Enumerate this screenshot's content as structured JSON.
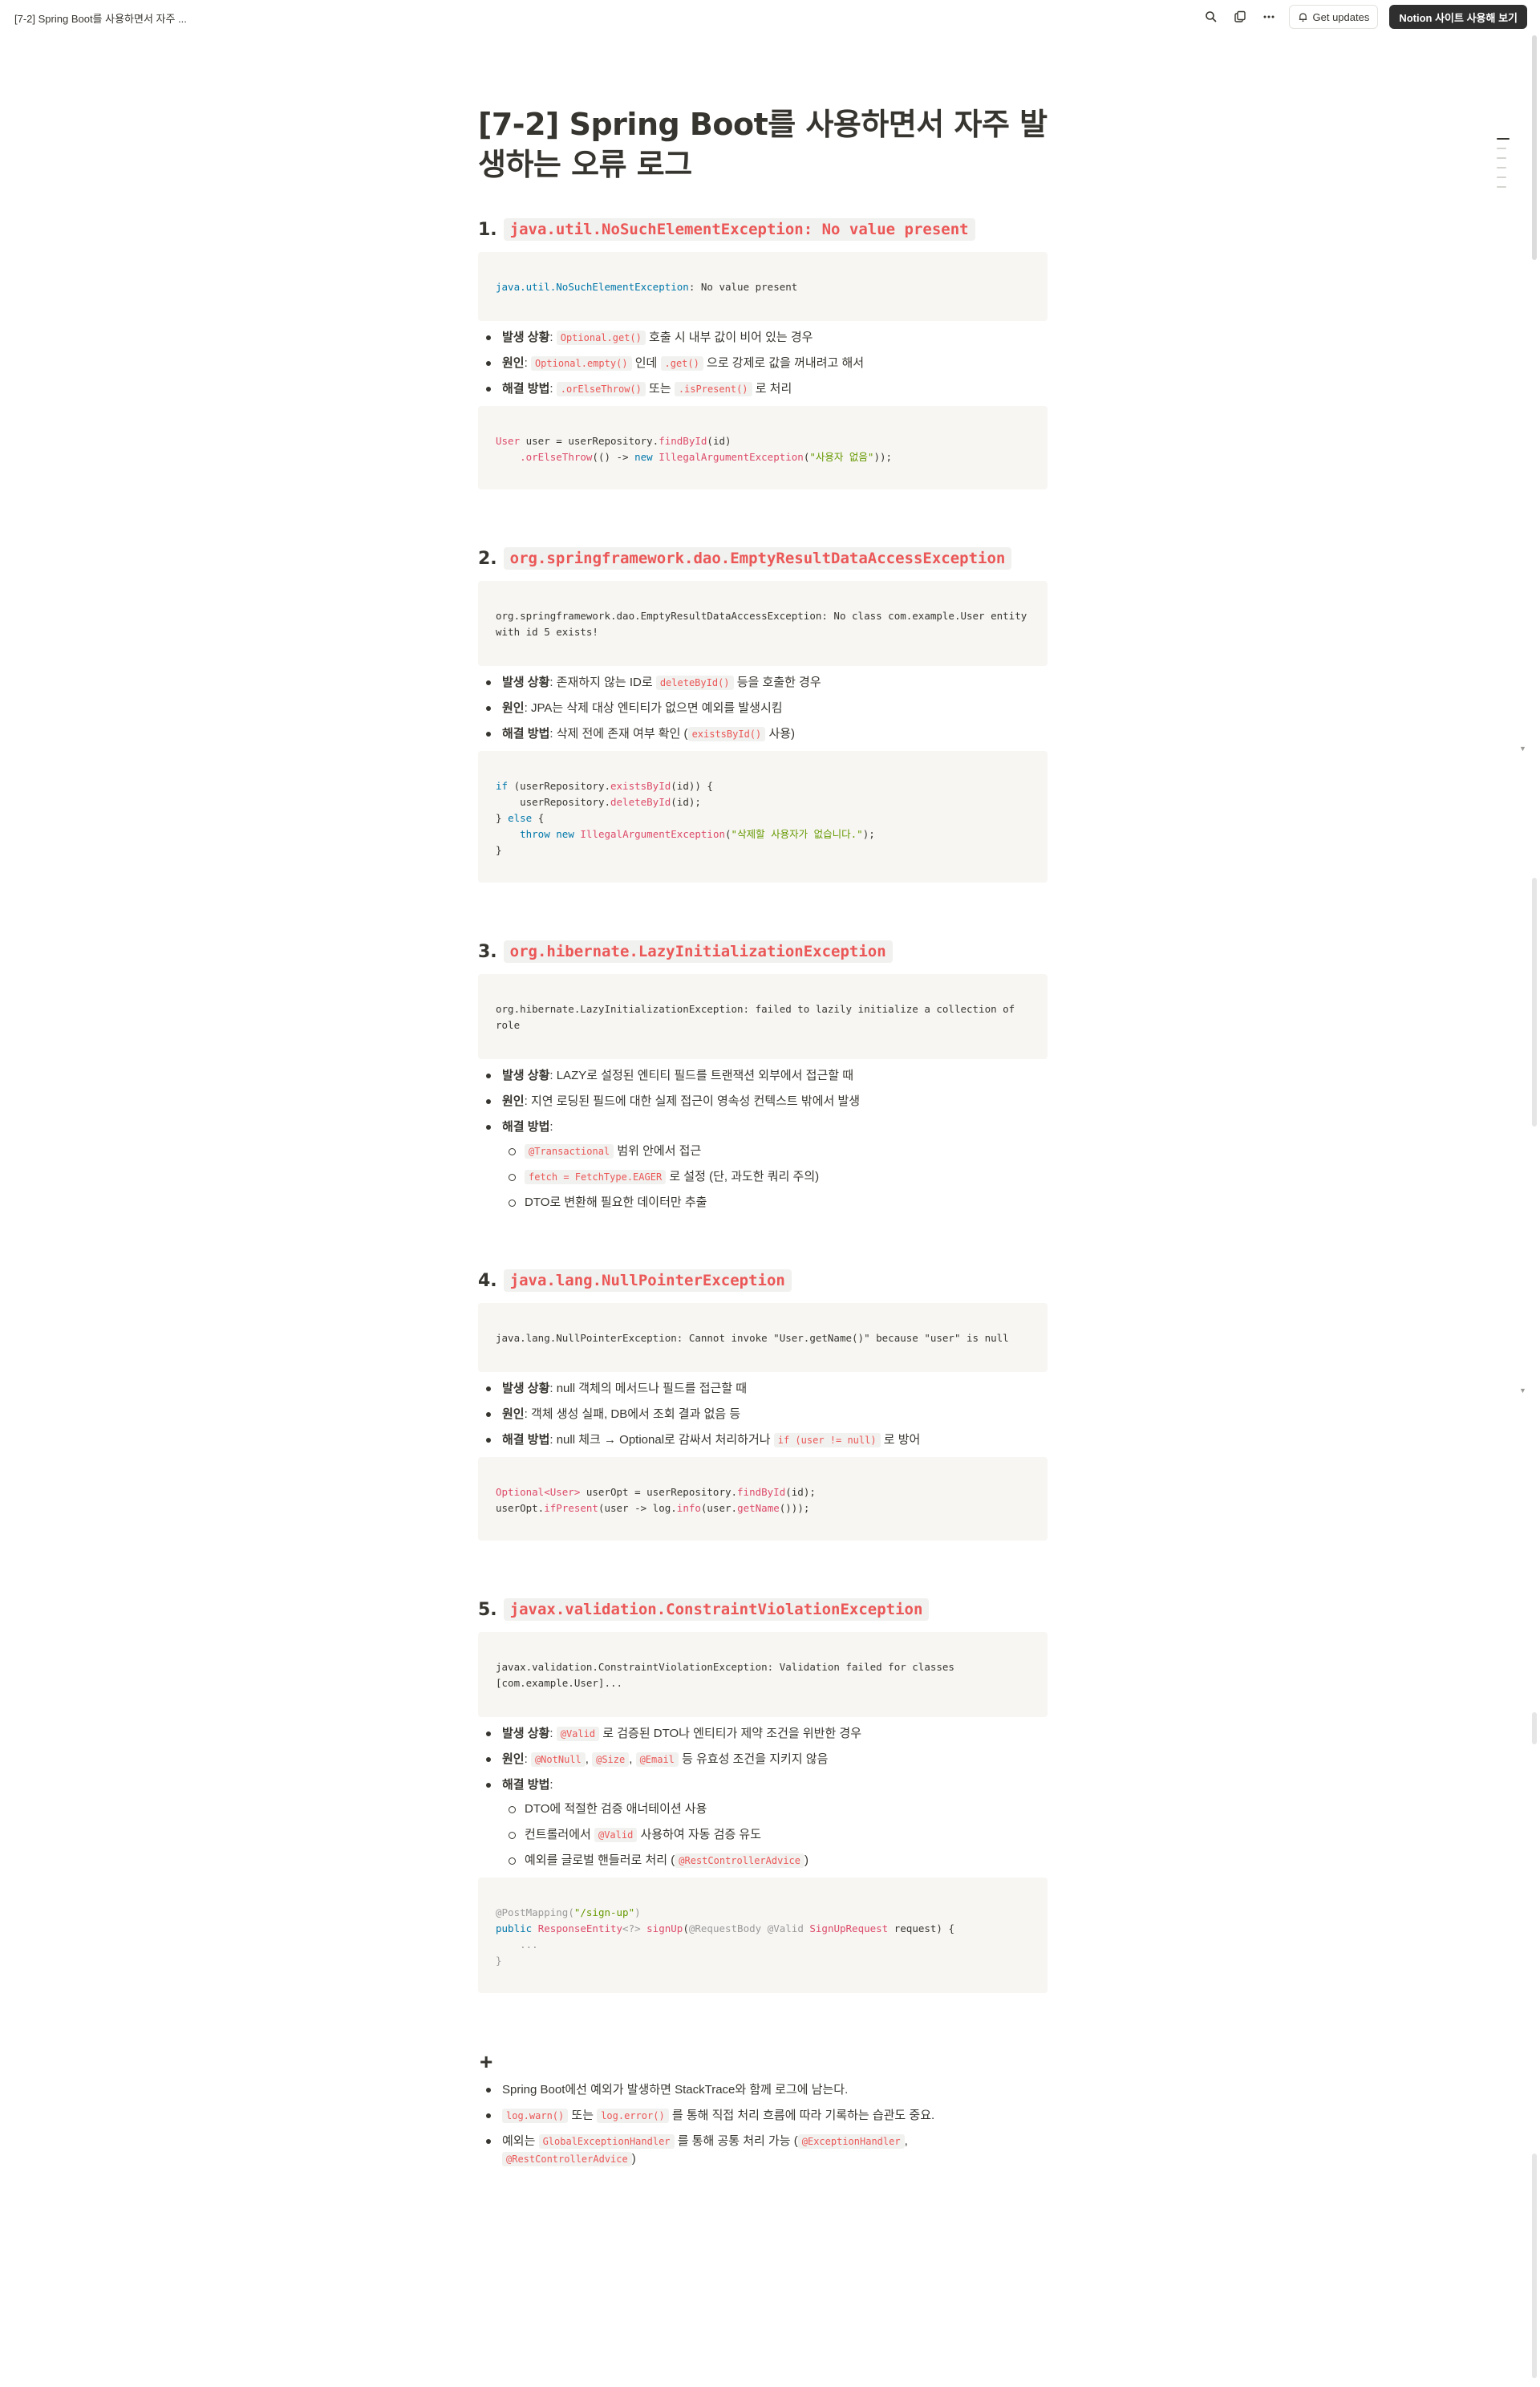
{
  "topbar": {
    "breadcrumb": "[7-2] Spring Boot를 사용하면서 자주 ...",
    "search_icon": "search-icon",
    "duplicate_icon": "duplicate-icon",
    "more_icon": "more-icon",
    "get_updates_label": "Get updates",
    "notion_button_label": "Notion 사이트 사용해 보기"
  },
  "page": {
    "title": "[7-2] Spring Boot를 사용하면서 자주 발생하는 오류 로그"
  },
  "sections": [
    {
      "num": "1.",
      "heading": "java.util.NoSuchElementException: No value present",
      "labels": {
        "situation": "발생 상황",
        "cause": "원인",
        "fix": "해결 방법"
      },
      "situation": {
        "code": "Optional.get()",
        "text": "호출 시 내부 값이 비어 있는 경우"
      },
      "cause": {
        "code1": "Optional.empty()",
        "mid": "인데",
        "code2": ".get()",
        "text": "으로 강제로 값을 꺼내려고 해서"
      },
      "fix": {
        "code1": ".orElseThrow()",
        "mid": "또는",
        "code2": ".isPresent()",
        "text": "로 처리"
      },
      "error_pkg": "java.util.",
      "error_cls": "NoSuchElementException",
      "error_rest": ": No value present",
      "code": {
        "l1_type": "User",
        "l1_var": " user = userRepository.",
        "l1_fn": "findById",
        "l1_end": "(id)",
        "l2_indent": "    ",
        "l2_fn": ".orElseThrow",
        "l2_mid": "(() -> ",
        "l2_kw": "new",
        "l2_cls": "IllegalArgumentException",
        "l2_str": "\"사용자 없음\"",
        "l2_end": "));"
      }
    },
    {
      "num": "2.",
      "heading": "org.springframework.dao.EmptyResultDataAccessException",
      "labels": {
        "situation": "발생 상황",
        "cause": "원인",
        "fix": "해결 방법"
      },
      "error": "org.springframework.dao.EmptyResultDataAccessException: No class com.example.User entity with id 5 exists!",
      "situation": {
        "pre": "존재하지 않는 ID로",
        "code": "deleteById()",
        "text": "등을 호출한 경우"
      },
      "cause": {
        "text": "JPA는 삭제 대상 엔티티가 없으면 예외를 발생시킴"
      },
      "fix": {
        "pre": "삭제 전에 존재 여부 확인 (",
        "code": "existsById()",
        "text": "사용)"
      },
      "code": {
        "l1_kw": "if",
        "l1_a": " (userRepository.",
        "l1_fn": "existsById",
        "l1_b": "(id)) {",
        "l2_a": "    userRepository.",
        "l2_fn": "deleteById",
        "l2_b": "(id);",
        "l3": "} ",
        "l3_kw": "else",
        "l3_b": " {",
        "l4_kw1": "throw",
        "l4_kw2": "new",
        "l4_cls": "IllegalArgumentException",
        "l4_str": "\"삭제할 사용자가 없습니다.\"",
        "l4_end": ");",
        "l5": "}"
      }
    },
    {
      "num": "3.",
      "heading": "org.hibernate.LazyInitializationException",
      "labels": {
        "situation": "발생 상황",
        "cause": "원인",
        "fix": "해결 방법"
      },
      "error": "org.hibernate.LazyInitializationException: failed to lazily initialize a collection of role",
      "situation": {
        "text": "LAZY로 설정된 엔티티 필드를 트랜잭션 외부에서 접근할 때"
      },
      "cause": {
        "text": "지연 로딩된 필드에 대한 실제 접근이 영속성 컨텍스트 밖에서 발생"
      },
      "fix_items": [
        {
          "code": "@Transactional",
          "text": "범위 안에서 접근"
        },
        {
          "code": "fetch = FetchType.EAGER",
          "text": "로 설정 (단, 과도한 쿼리 주의)"
        },
        {
          "code": "",
          "text": "DTO로 변환해 필요한 데이터만 추출"
        }
      ]
    },
    {
      "num": "4.",
      "heading": "java.lang.NullPointerException",
      "labels": {
        "situation": "발생 상황",
        "cause": "원인",
        "fix": "해결 방법"
      },
      "error": "java.lang.NullPointerException: Cannot invoke \"User.getName()\" because \"user\" is null",
      "situation": {
        "text": "null 객체의 메서드나 필드를 접근할 때"
      },
      "cause": {
        "text": "객체 생성 실패, DB에서 조회 결과 없음 등"
      },
      "fix": {
        "pre": "null 체크 → Optional로 감싸서 처리하거나",
        "code": "if (user != null)",
        "text": "로 방어"
      },
      "code": {
        "l1_type": "Optional<User>",
        "l1_a": " userOpt = userRepository.",
        "l1_fn": "findById",
        "l1_b": "(id);",
        "l2_a": "userOpt.",
        "l2_fn": "ifPresent",
        "l2_b": "(user -> log.",
        "l2_fn2": "info",
        "l2_c": "(user.",
        "l2_fn3": "getName",
        "l2_d": "()));"
      }
    },
    {
      "num": "5.",
      "heading": "javax.validation.ConstraintViolationException",
      "labels": {
        "situation": "발생 상황",
        "cause": "원인",
        "fix": "해결 방법"
      },
      "error": "javax.validation.ConstraintViolationException: Validation failed for classes [com.example.User]...",
      "situation": {
        "code": "@Valid",
        "text": "로 검증된 DTO나 엔티티가 제약 조건을 위반한 경우"
      },
      "cause": {
        "code1": "@NotNull",
        "code2": "@Size",
        "code3": "@Email",
        "text": "등 유효성 조건을 지키지 않음"
      },
      "fix_items": [
        {
          "pre": "DTO에 적절한 검증 애너테이션 사용"
        },
        {
          "pre": "컨트롤러에서",
          "code": "@Valid",
          "text": "사용하여 자동 검증 유도"
        },
        {
          "pre": "예외를 글로벌 핸들러로 처리 (",
          "code": "@RestControllerAdvice",
          "text": ")"
        }
      ],
      "code": {
        "l1_ann": "@PostMapping",
        "l1_a": "(",
        "l1_str": "\"/sign-up\"",
        "l1_b": ")",
        "l2_kw": "public",
        "l2_type": "ResponseEntity",
        "l2_gen": "<?>",
        "l2_fn": "signUp",
        "l2_ann1": "@RequestBody",
        "l2_ann2": "@Valid",
        "l2_cls": "SignUpRequest",
        "l2_end": " request) {",
        "l3": "    ...",
        "l4": "}"
      }
    }
  ],
  "footer": {
    "plus": "+",
    "items": [
      {
        "text": "Spring Boot에선 예외가 발생하면 StackTrace와 함께 로그에 남는다."
      },
      {
        "code1": "log.warn()",
        "mid": "또는",
        "code2": "log.error()",
        "text": "를 통해 직접 처리 흐름에 따라 기록하는 습관도 중요."
      },
      {
        "pre": "예외는",
        "code1": "GlobalExceptionHandler",
        "mid": "를 통해 공통 처리 가능 (",
        "code2": "@ExceptionHandler",
        "sep": ",",
        "code3": "@RestControllerAdvice",
        "end": ")"
      }
    ]
  }
}
